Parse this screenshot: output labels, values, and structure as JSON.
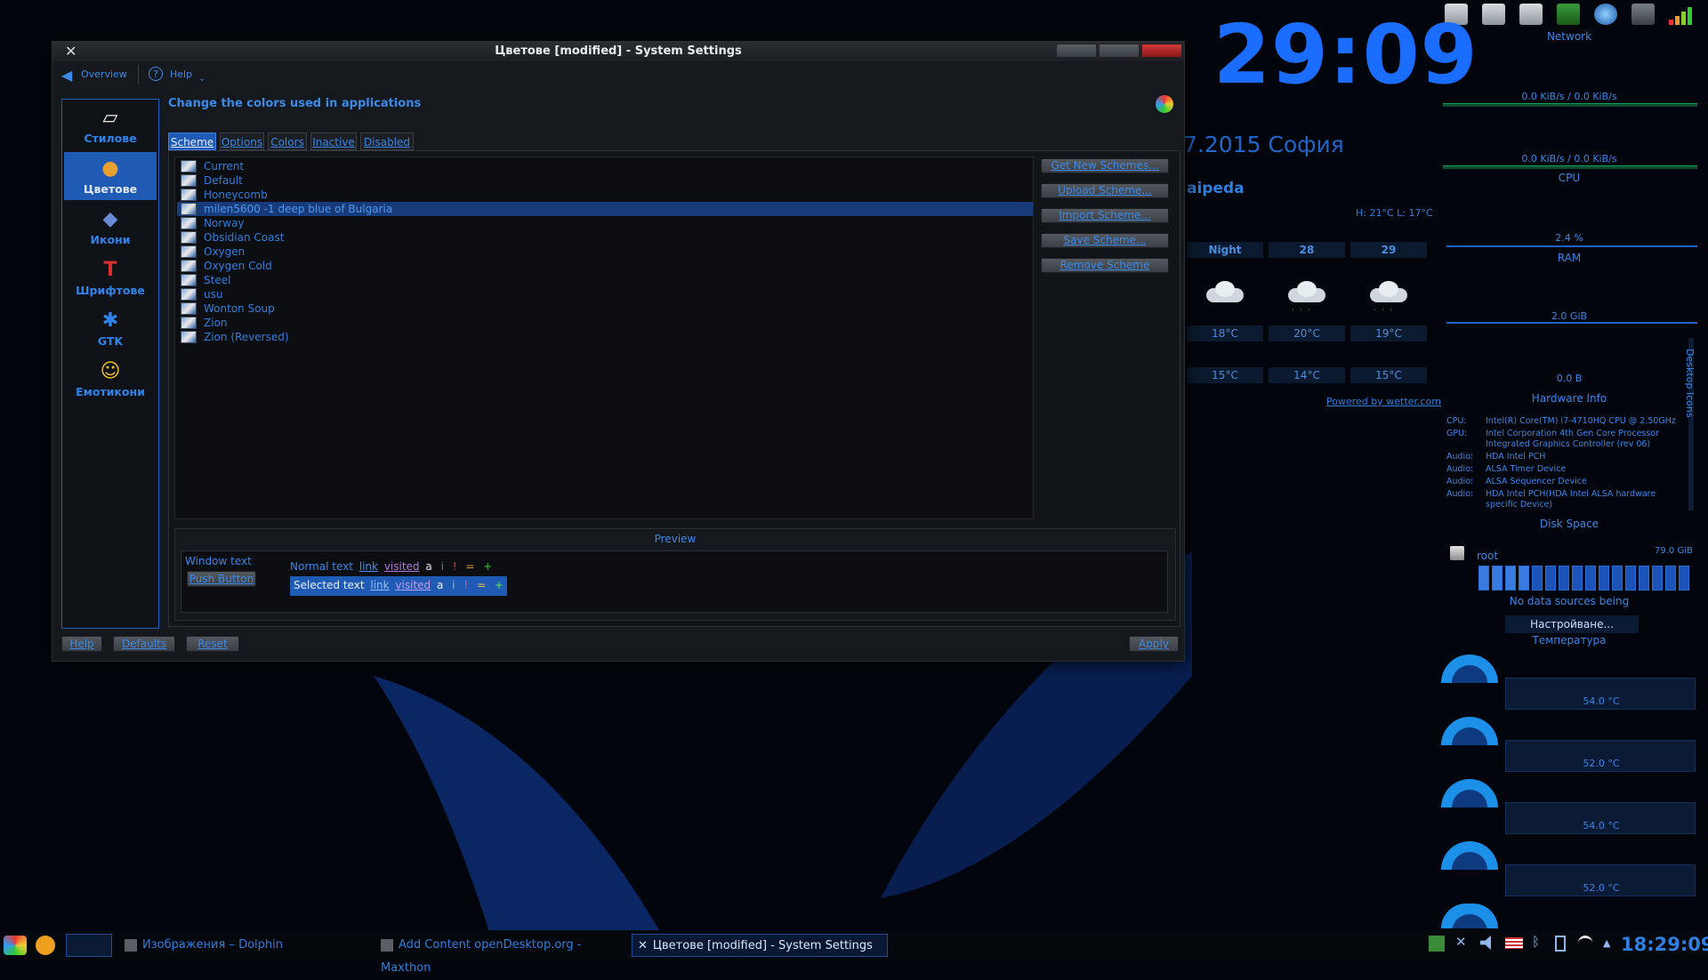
{
  "window": {
    "title": "Цветове [modified] - System Settings",
    "nav": {
      "overview": "Overview",
      "help": "Help"
    },
    "sidebar": [
      {
        "label": "Стилове",
        "icon": "style-icon"
      },
      {
        "label": "Цветове",
        "icon": "colors-icon",
        "active": true
      },
      {
        "label": "Икони",
        "icon": "icons-icon"
      },
      {
        "label": "Шрифтове",
        "icon": "fonts-icon"
      },
      {
        "label": "GTK",
        "icon": "gtk-icon"
      },
      {
        "label": "Емотикони",
        "icon": "emoticons-icon"
      }
    ],
    "heading": "Change the colors used in applications",
    "tabs": [
      "Scheme",
      "Options",
      "Colors",
      "Inactive",
      "Disabled"
    ],
    "active_tab": "Scheme",
    "schemes": [
      "Current",
      "Default",
      "Honeycomb",
      "milen5600 -1 deep blue of Bulgaria",
      "Norway",
      "Obsidian Coast",
      "Oxygen",
      "Oxygen Cold",
      "Steel",
      "usu",
      "Wonton Soup",
      "Zion",
      "Zion (Reversed)"
    ],
    "selected_scheme": "milen5600 -1 deep blue of Bulgaria",
    "scheme_buttons": [
      "Get New Schemes...",
      "Upload Scheme...",
      "Import Scheme...",
      "Save Scheme...",
      "Remove Scheme"
    ],
    "preview": {
      "label": "Preview",
      "window_text": "Window text",
      "push_button": "Push Button",
      "normal": {
        "text": "Normal text",
        "link": "link",
        "visited": "visited",
        "a": "a",
        "i": "i",
        "bang": "!",
        "eq": "=",
        "plus": "+"
      },
      "selected": {
        "text": "Selected text",
        "link": "link",
        "visited": "visited",
        "a": "a",
        "i": "i",
        "bang": "!",
        "eq": "=",
        "plus": "+"
      }
    },
    "footer": {
      "help": "Help",
      "defaults": "Defaults",
      "reset": "Reset",
      "apply": "Apply"
    }
  },
  "clock": {
    "time": "29:09",
    "date_fragment": "7.2015 София"
  },
  "weather": {
    "city_fragment": "aipeda",
    "high_low": "H: 21°C L: 17°C",
    "days": [
      "Night",
      "28",
      "29"
    ],
    "high_temps": [
      "18°C",
      "20°C",
      "19°C"
    ],
    "low_temps": [
      "15°C",
      "14°C",
      "15°C"
    ],
    "powered_by": "Powered by wetter.com"
  },
  "right_panel": {
    "network_title": "Network",
    "net_rate1": "0.0 KiB/s / 0.0 KiB/s",
    "net_rate2": "0.0 KiB/s / 0.0 KiB/s",
    "cpu_title": "CPU",
    "cpu_value": "2.4 %",
    "ram_title": "RAM",
    "ram_value": "2.0 GiB",
    "swap_value": "0.0 B",
    "hw_title": "Hardware Info",
    "hw": [
      {
        "k": "CPU:",
        "v": "Intel(R) Core(TM) i7-4710HQ CPU @ 2.50GHz"
      },
      {
        "k": "GPU:",
        "v": "Intel Corporation 4th Gen Core Processor Integrated Graphics Controller (rev 06)"
      },
      {
        "k": "Audio:",
        "v": "HDA Intel PCH"
      },
      {
        "k": "Audio:",
        "v": "ALSA Timer Device"
      },
      {
        "k": "Audio:",
        "v": "ALSA Sequencer Device"
      },
      {
        "k": "Audio:",
        "v": "HDA Intel PCH(HDA Intel ALSA hardware specific Device)"
      }
    ],
    "disk_title": "Disk Space",
    "disk_name": "root",
    "disk_size": "79.0 GiB",
    "no_data": "No data sources being",
    "configure": "Настройване...",
    "temp_title": "Температура",
    "temps": [
      "54.0 °C",
      "52.0 °C",
      "54.0 °C",
      "52.0 °C"
    ],
    "desktop_icons_label": "Desktop Icons"
  },
  "taskbar": {
    "tasks": [
      "Изображения – Dolphin",
      "Add  Content openDesktop.org - Maxthon",
      "Цветове [modified] - System Settings"
    ],
    "time": "18:29:09"
  }
}
